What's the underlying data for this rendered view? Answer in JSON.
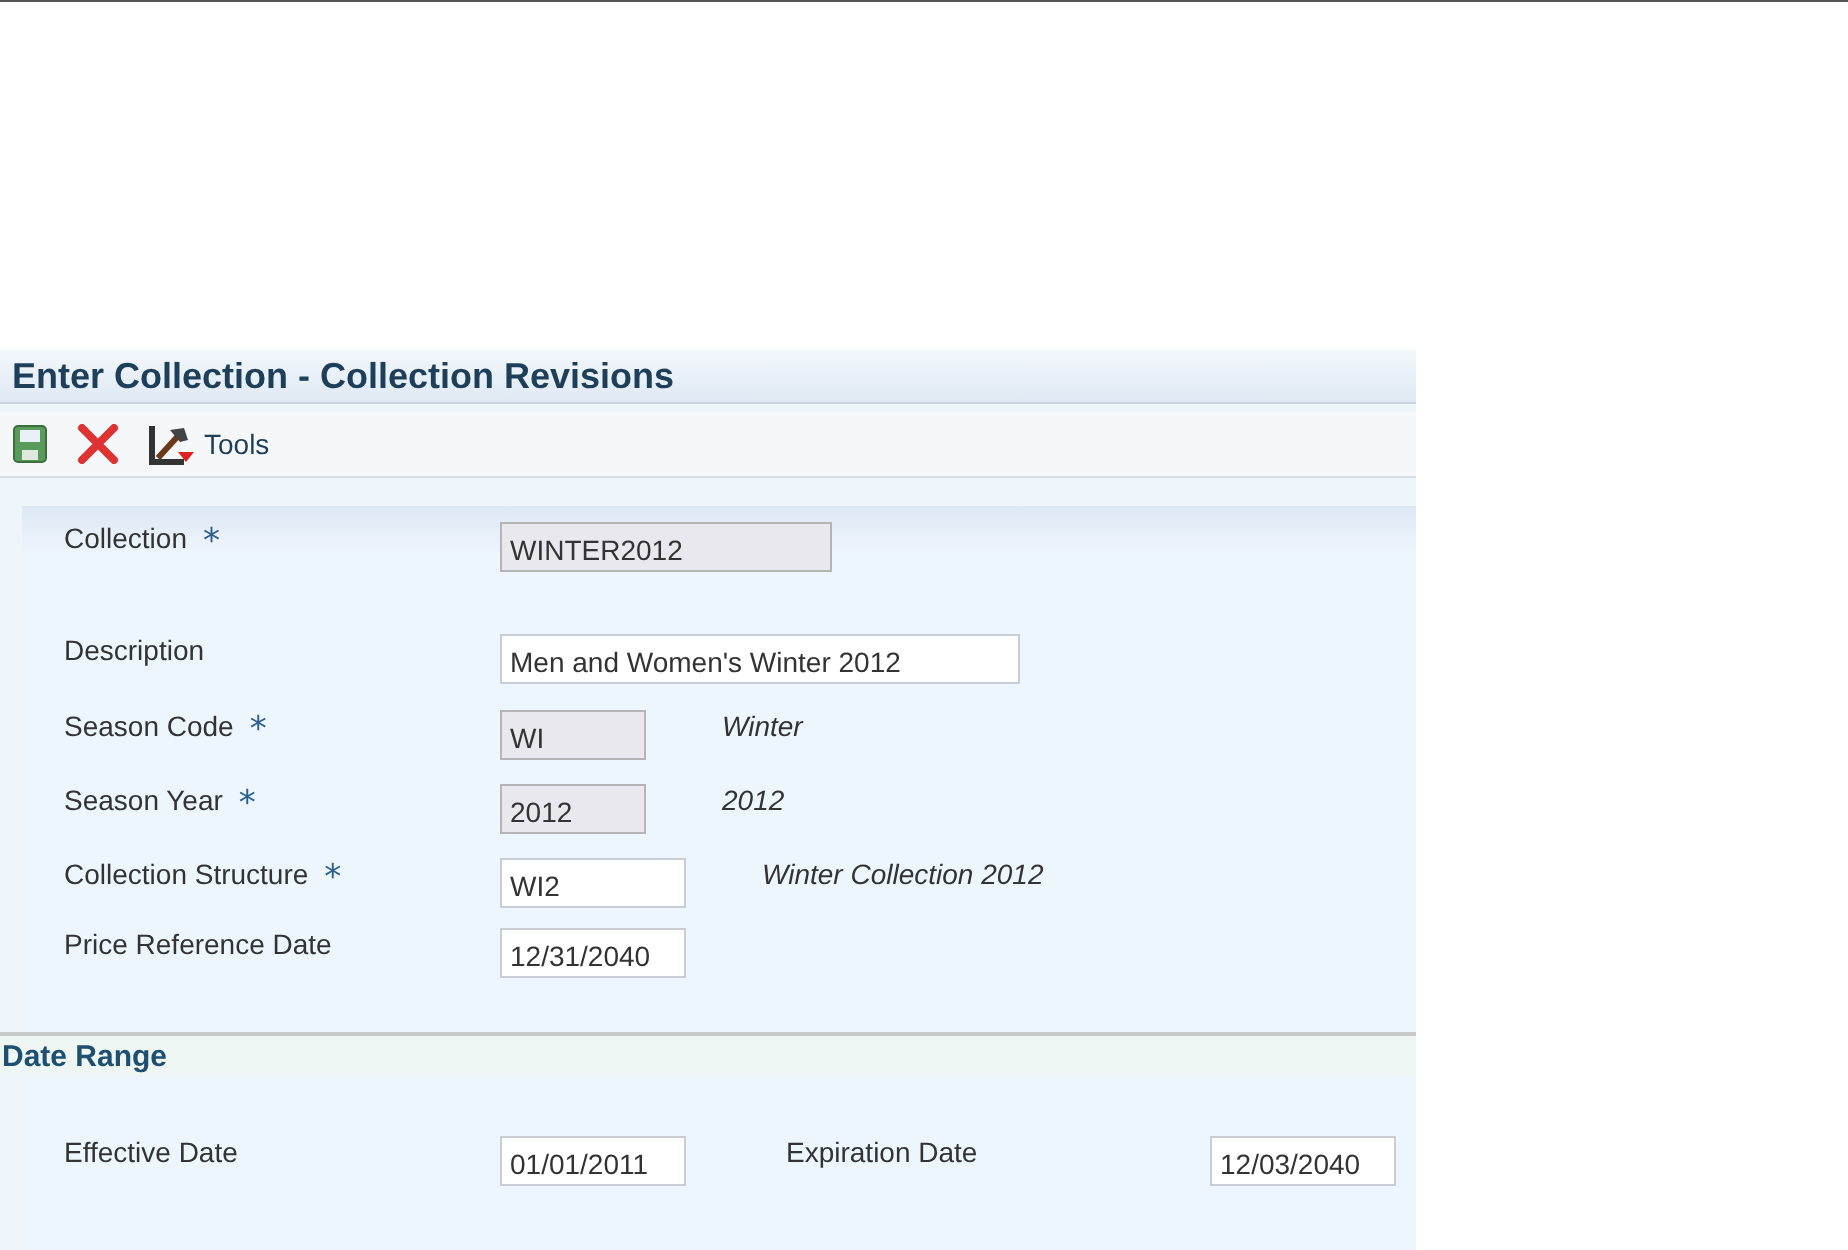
{
  "form": {
    "title": "Enter Collection - Collection Revisions"
  },
  "toolbar": {
    "tools_label": "Tools"
  },
  "fields": [
    {
      "label": "Collection",
      "required_mark": "*",
      "value": "WINTER2012",
      "disabled": true
    },
    {
      "label": "Description",
      "value": "Men and Women's Winter 2012",
      "disabled": false
    },
    {
      "label": "Season Code",
      "required_mark": "*",
      "value": "WI",
      "disabled": true,
      "description": "Winter"
    },
    {
      "label": "Season Year",
      "required_mark": "*",
      "value": "2012",
      "disabled": true,
      "description": "2012"
    },
    {
      "label": "Collection Structure",
      "required_mark": "*",
      "value": "WI2",
      "disabled": false,
      "description": "Winter Collection 2012"
    },
    {
      "label": "Price Reference Date",
      "value": "12/31/2040",
      "disabled": false
    }
  ],
  "date_range": {
    "title": "Date Range",
    "fields": [
      {
        "label": "Effective Date",
        "value": "01/01/2011",
        "disabled": false
      },
      {
        "label": "Expiration Date",
        "value": "12/03/2040",
        "disabled": false
      }
    ]
  }
}
